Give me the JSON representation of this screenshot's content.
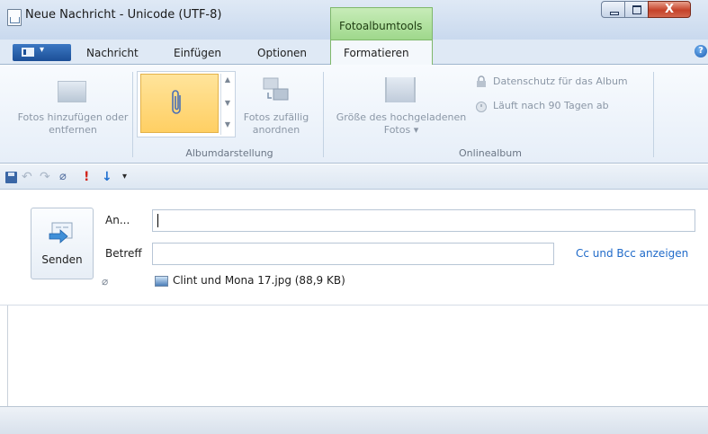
{
  "window": {
    "title": "Neue Nachricht - Unicode (UTF-8)",
    "context_tab": "Fotoalbumtools",
    "close_glyph": "X"
  },
  "ribbon": {
    "tabs": [
      "Nachricht",
      "Einfügen",
      "Optionen",
      "Formatieren"
    ],
    "active_tab": "Formatieren",
    "app_menu_arrow": "▾",
    "help_glyph": "?",
    "buttons": {
      "fotos_hinzufuegen": "Fotos hinzufügen oder entfernen",
      "fotos_zufaellig": "Fotos zufällig anordnen",
      "groesse": "Größe des hochgeladenen Fotos ▾",
      "datenschutz": "Datenschutz für das Album",
      "laeuft_ab": "Läuft nach 90 Tagen ab"
    },
    "groups": {
      "albumdarstellung": "Albumdarstellung",
      "onlinealbum": "Onlinealbum"
    }
  },
  "quick_access": {
    "undo": "↶",
    "redo": "↷",
    "attach": "⌀",
    "priority_high": "!",
    "priority_low": "↓",
    "more": "▾"
  },
  "compose": {
    "send_label": "Senden",
    "to_label": "An...",
    "to_value": "",
    "subject_label": "Betreff",
    "subject_value": "",
    "cc_bcc_link": "Cc und Bcc anzeigen",
    "attachment_icon": "⌀",
    "attachment": "Clint und Mona 17.jpg (88,9 KB)"
  },
  "colors": {
    "context_tab_green": "#9fd88c",
    "selected_gallery": "#ffcf63",
    "link_blue": "#1f6ac9",
    "priority_red": "#d2261c"
  }
}
